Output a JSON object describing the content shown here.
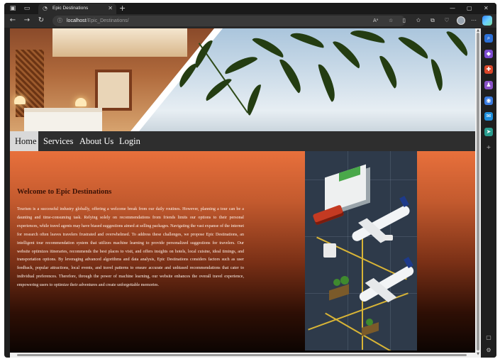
{
  "browser": {
    "tab": {
      "title": "Epic Destinations",
      "close_glyph": "✕"
    },
    "new_tab_glyph": "+",
    "window_controls": [
      "—",
      "▢",
      "✕"
    ],
    "nav": {
      "back": "←",
      "forward": "→",
      "reload": "↻"
    },
    "address": {
      "host": "localhost",
      "path": "/Epic_Destinations/"
    },
    "toolbar_icons": [
      "read-aloud-icon",
      "favorite-star-icon",
      "split-screen-icon",
      "favorites-icon",
      "collections-icon",
      "browser-essentials-icon",
      "profile-icon",
      "more-icon",
      "copilot-icon"
    ],
    "sidebar_icons": [
      "search-icon",
      "shopping-icon",
      "tools-icon",
      "games-icon",
      "office-icon",
      "outlook-icon",
      "drop-icon",
      "add-icon",
      "layout-icon",
      "settings-icon"
    ]
  },
  "nav": {
    "items": [
      {
        "label": "Home",
        "active": true
      },
      {
        "label": "Services",
        "active": false
      },
      {
        "label": "About Us",
        "active": false
      },
      {
        "label": "Login",
        "active": false
      }
    ]
  },
  "main": {
    "title": "Welcome to Epic Destinations",
    "body": "Tourism is a successful industry globally, offering a welcome break from our daily routines. However, planning a tour can be a daunting and time-consuming task. Relying solely on recommendations from friends limits our options to their personal experiences, while travel agents may have biased suggestions aimed at selling packages. Navigating the vast expanse of the internet for research often leaves travelers frustrated and overwhelmed. To address these challenges, we propose Epic Destinations, an intelligent tour recommendation system that utilizes machine learning to provide personalized suggestions for travelers. Our website optimizes itineraries, recommends the best places to visit, and offers insights on hotels, local cuisine, ideal timings, and transportation options. By leveraging advanced algorithms and data analysis, Epic Destinations considers factors such as user feedback, popular attractions, local events, and travel patterns to ensure accurate and unbiased recommendations that cater to individual preferences. Therefore, through the power of machine learning, our website enhances the overall travel experience, empowering users to optimize their adventures and create unforgettable memories."
  },
  "colors": {
    "accent_orange": "#e8703c",
    "nav_bg": "#2e2e2e",
    "nav_active_bg": "#d9d9d9"
  }
}
